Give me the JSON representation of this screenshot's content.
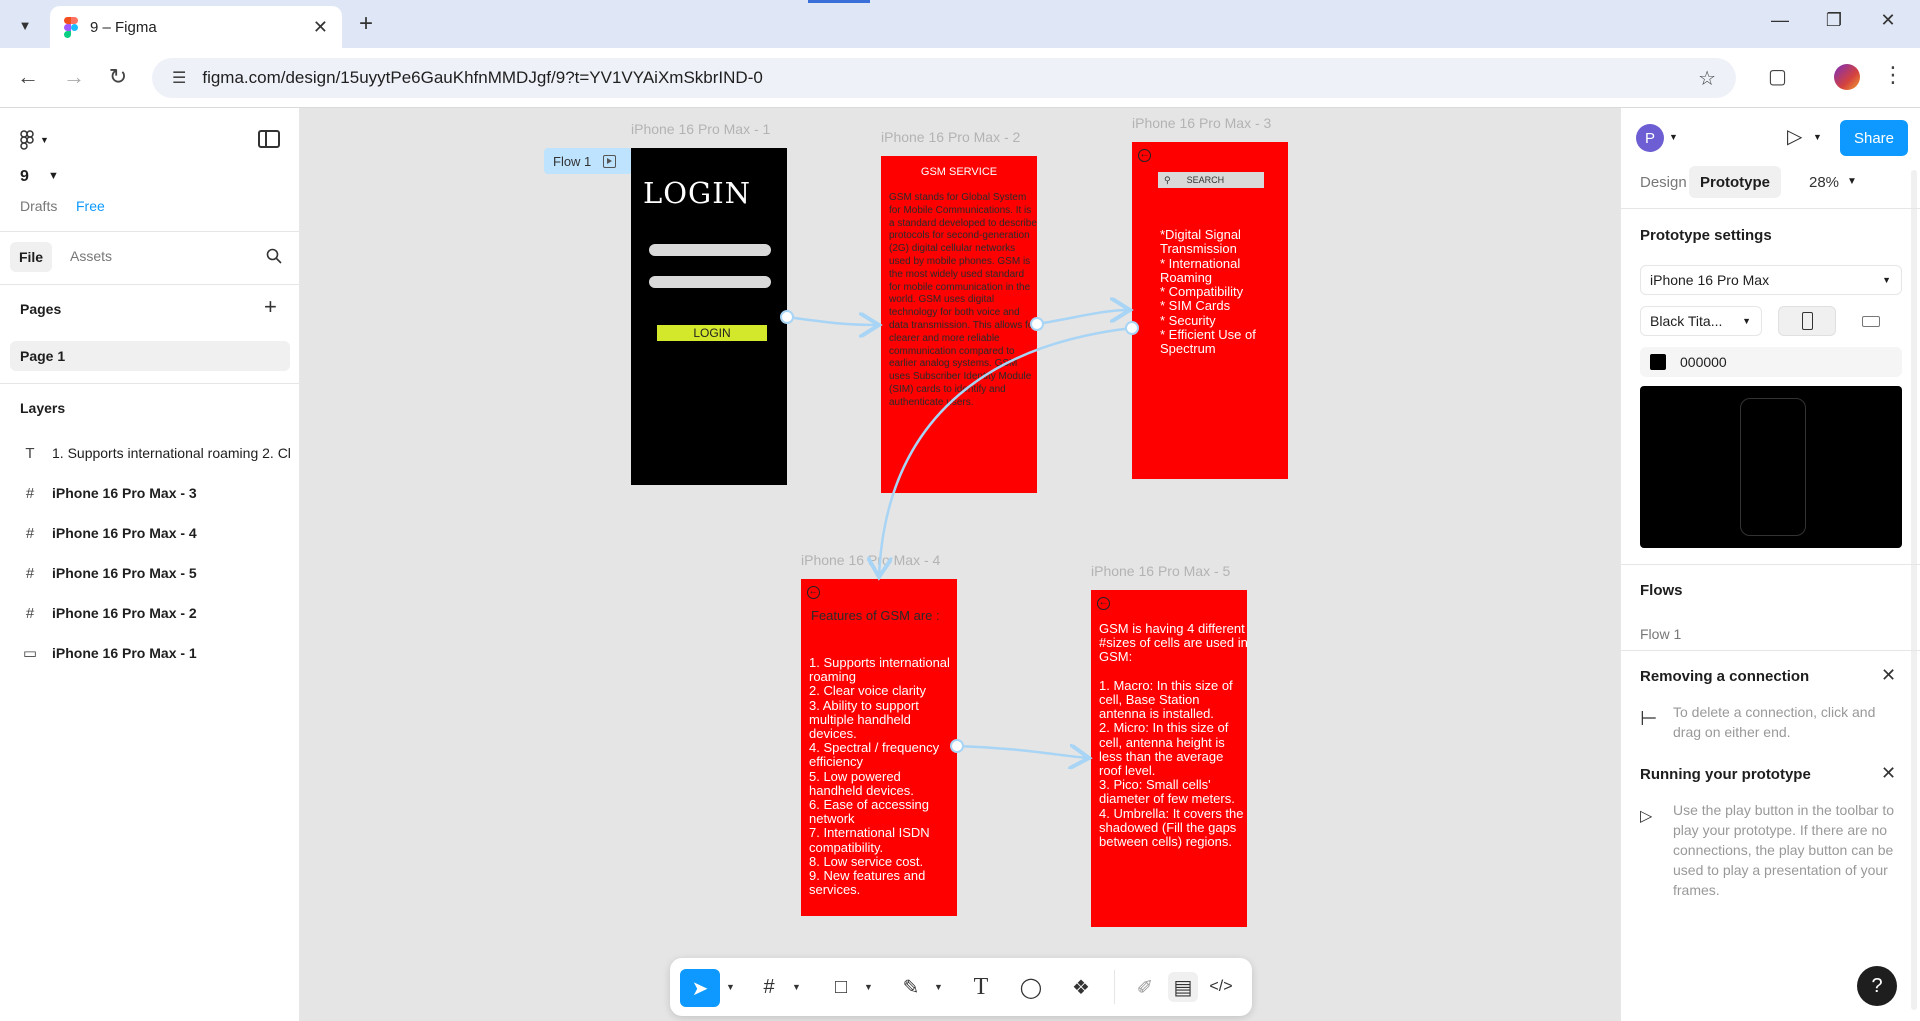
{
  "browser": {
    "tab_title": "9 – Figma",
    "url": "figma.com/design/15uyytPe6GauKhfnMMDJgf/9?t=YV1VYAiXmSkbrIND-0"
  },
  "left_panel": {
    "file_name": "9",
    "location": "Drafts",
    "plan": "Free",
    "tab_file": "File",
    "tab_assets": "Assets",
    "pages_title": "Pages",
    "pages": [
      "Page 1"
    ],
    "layers_title": "Layers",
    "layers": [
      {
        "icon": "text-icon",
        "name": "1. Supports international roaming 2. Cl"
      },
      {
        "icon": "frame-icon",
        "name": "iPhone 16 Pro Max - 3"
      },
      {
        "icon": "frame-icon",
        "name": "iPhone 16 Pro Max - 4"
      },
      {
        "icon": "frame-icon",
        "name": "iPhone 16 Pro Max - 5"
      },
      {
        "icon": "frame-icon",
        "name": "iPhone 16 Pro Max - 2"
      },
      {
        "icon": "rectangle-icon",
        "name": "iPhone 16 Pro Max - 1"
      }
    ]
  },
  "canvas": {
    "flow_badge": "Flow 1",
    "frames": {
      "f1": {
        "label": "iPhone 16 Pro Max - 1",
        "title": "LOGIN",
        "button": "LOGIN"
      },
      "f2": {
        "label": "iPhone 16 Pro Max - 2",
        "heading": "GSM SERVICE",
        "body": "GSM stands for Global System for Mobile Communications. It is a standard developed to describe protocols for second-generation (2G) digital cellular networks used by mobile phones. GSM is the most widely used standard for mobile communication in the world. GSM uses digital technology for both voice and data transmission. This allows for clearer and more reliable communication compared to earlier analog systems. GSM uses Subscriber Identity Module (SIM) cards to identify and authenticate users."
      },
      "f3": {
        "label": "iPhone 16 Pro Max - 3",
        "search": "SEARCH",
        "body": "*Digital Signal Transmission\n* International Roaming\n* Compatibility\n* SIM Cards\n* Security\n* Efficient Use of Spectrum"
      },
      "f4": {
        "label": "iPhone 16 Pro Max - 4",
        "heading": "Features of GSM are :",
        "body": "1. Supports international roaming\n2. Clear voice clarity\n3. Ability to support multiple handheld devices.\n4. Spectral / frequency efficiency\n5. Low powered handheld devices.\n6. Ease of accessing network\n7. International ISDN compatibility.\n8. Low service cost.\n9. New features and services."
      },
      "f5": {
        "label": "iPhone 16 Pro Max - 5",
        "body": "GSM is having 4 different #sizes of cells are used in GSM:\n\n1. Macro: In this size of cell, Base Station antenna is installed.\n2. Micro: In this size of cell, antenna height is less than the average roof level.\n3. Pico: Small cells' diameter of few meters.\n4. Umbrella: It covers the shadowed (Fill the gaps between cells) regions."
      }
    }
  },
  "right_panel": {
    "avatar_initial": "P",
    "share_label": "Share",
    "tab_design": "Design",
    "tab_prototype": "Prototype",
    "zoom": "28%",
    "proto_settings_title": "Prototype settings",
    "device": "iPhone 16 Pro Max",
    "device_color": "Black Tita...",
    "bg_color_hex": "000000",
    "flows_title": "Flows",
    "flows": [
      "Flow 1"
    ],
    "removing_title": "Removing a connection",
    "removing_text": "To delete a connection, click and drag on either end.",
    "running_title": "Running your prototype",
    "running_text": "Use the play button in the toolbar to play your prototype. If there are no connections, the play button can be used to play a presentation of your frames.",
    "help": "?"
  },
  "colors": {
    "accent": "#0d99ff",
    "frame_red": "#ff0000",
    "connection": "#a8d4f5",
    "login_button": "#d4e82b"
  }
}
